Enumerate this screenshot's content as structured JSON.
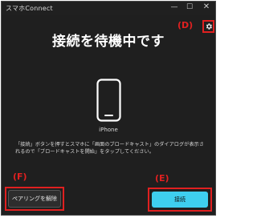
{
  "window": {
    "title": "スマホConnect",
    "min_glyph": "—",
    "max_glyph": "☐",
    "close_glyph": "✕"
  },
  "headline": "接続を待機中です",
  "markers": {
    "settings": "(D)",
    "pair": "(F)",
    "connect": "(E)"
  },
  "device": {
    "icon": "smartphone-icon",
    "name": "iPhone"
  },
  "instruction": "「接続」ボタンを押すとスマホに「画面のブロードキャスト」のダイアログが表示されるので「ブロードキャストを開始」をタップしてください。",
  "buttons": {
    "unpair_label": "ペアリングを解除",
    "connect_label": "接続"
  },
  "colors": {
    "accent": "#3ecfef",
    "annotation": "#e02020",
    "background": "#1f1f1f"
  },
  "icons": {
    "settings": "gear-icon"
  }
}
